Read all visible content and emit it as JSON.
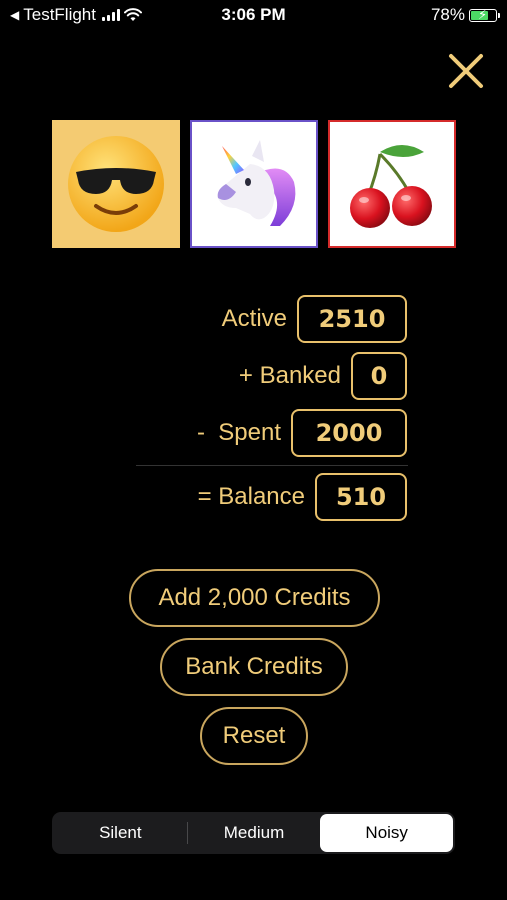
{
  "status_bar": {
    "back_app": "TestFlight",
    "time": "3:06 PM",
    "battery_percent": "78%",
    "battery_level": 0.78
  },
  "reels": [
    {
      "emoji": "😎",
      "name": "smiling face with sunglasses"
    },
    {
      "emoji": "🦄",
      "name": "unicorn"
    },
    {
      "emoji": "🍒",
      "name": "cherries"
    }
  ],
  "stats": {
    "active": {
      "label": "Active",
      "value": "2510"
    },
    "banked": {
      "label": "+ Banked",
      "value": "0"
    },
    "spent": {
      "label": "-  Spent",
      "value": "2000"
    },
    "balance": {
      "label": "= Balance",
      "value": "510"
    }
  },
  "buttons": {
    "add_credits": "Add 2,000 Credits",
    "bank_credits": "Bank Credits",
    "reset": "Reset"
  },
  "sound_mode": {
    "options": [
      "Silent",
      "Medium",
      "Noisy"
    ],
    "selected": "Noisy"
  },
  "colors": {
    "accent": "#f0cc7a",
    "border": "#c9a65e",
    "background": "#000000"
  }
}
